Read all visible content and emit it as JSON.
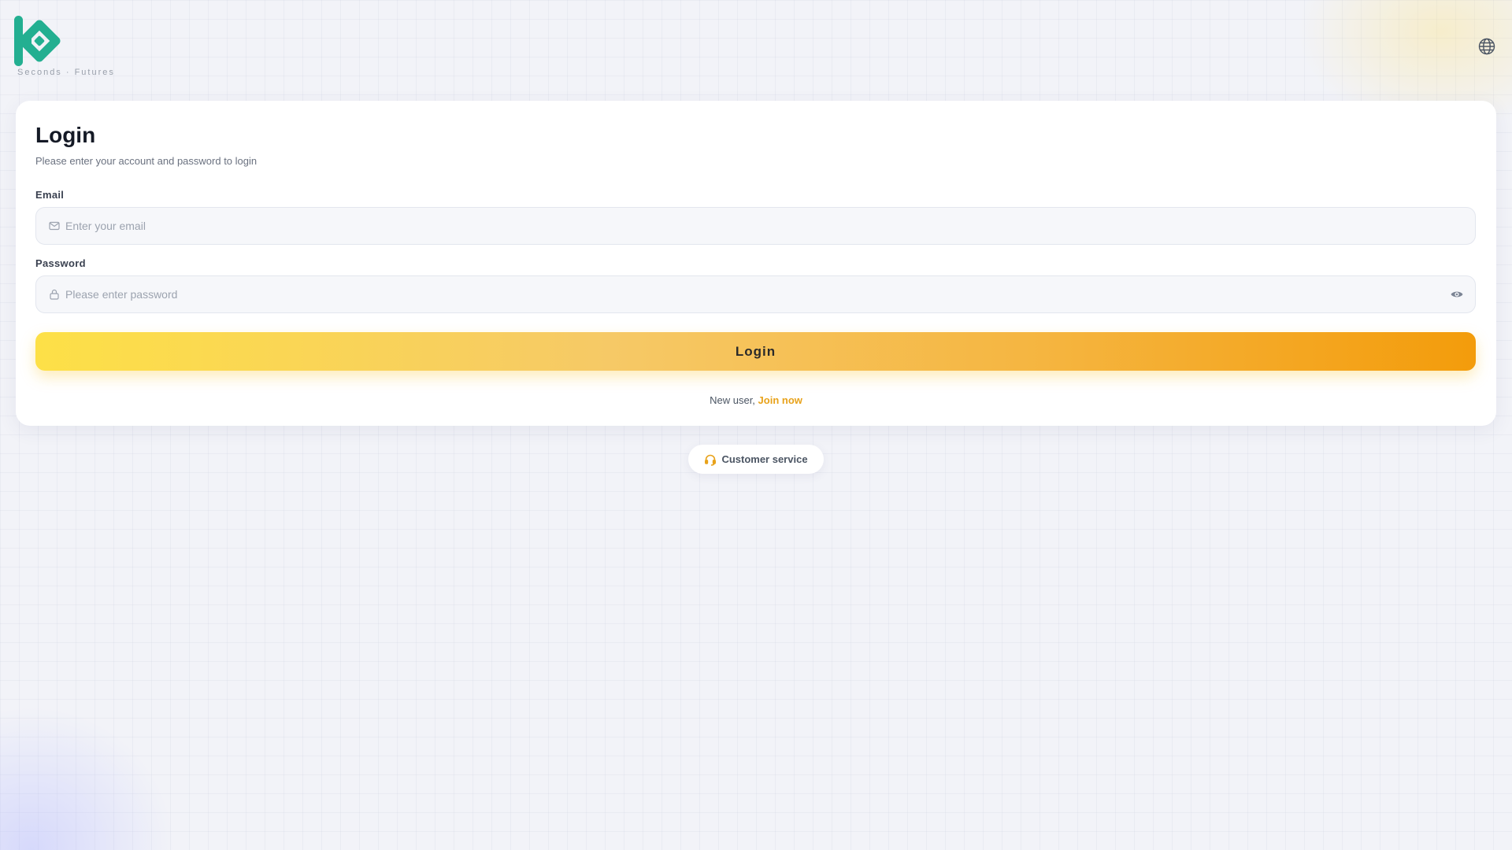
{
  "header": {
    "tagline": "Seconds · Futures",
    "logo_icon": "kucoin-logo-icon",
    "language_icon": "globe-icon"
  },
  "login": {
    "title": "Login",
    "subtitle": "Please enter your account and password to login",
    "email": {
      "label": "Email",
      "placeholder": "Enter your email",
      "value": "",
      "icon": "mail-icon"
    },
    "password": {
      "label": "Password",
      "placeholder": "Please enter password",
      "value": "",
      "icon": "lock-icon",
      "toggle_icon": "eye-icon"
    },
    "submit_label": "Login",
    "signup_prompt": "New user,",
    "signup_link": "Join now"
  },
  "support": {
    "label": "Customer service",
    "icon": "headset-icon"
  },
  "colors": {
    "brand": "#23af91",
    "accent": "#e8a21a",
    "button_start": "#fde047",
    "button_end": "#f39c0b"
  }
}
